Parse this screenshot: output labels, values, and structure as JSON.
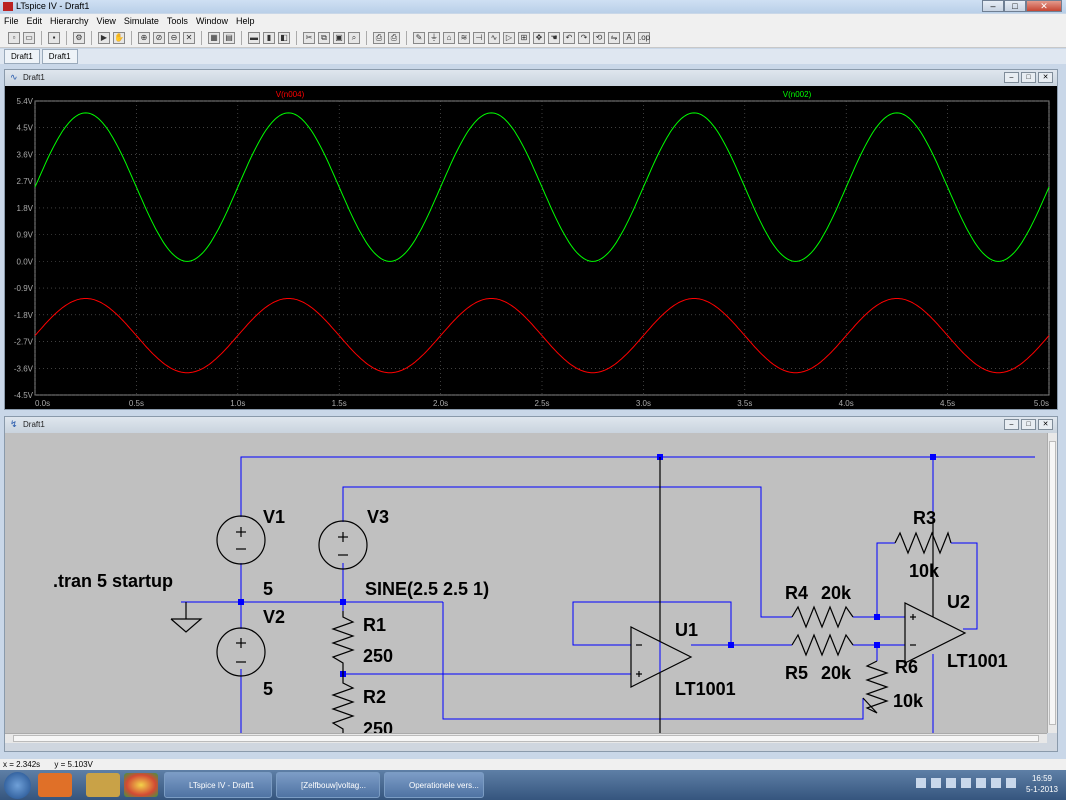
{
  "app": {
    "title": "LTspice IV - Draft1"
  },
  "menu": [
    "File",
    "Edit",
    "Hierarchy",
    "View",
    "Simulate",
    "Tools",
    "Window",
    "Help"
  ],
  "doc_tabs": [
    "Draft1",
    "Draft1"
  ],
  "plot_window": {
    "title": "Draft1"
  },
  "schematic_window": {
    "title": "Draft1"
  },
  "chart_data": {
    "type": "line",
    "xlim": [
      0,
      5
    ],
    "ylim": [
      -4.5,
      5.4
    ],
    "x_ticks": [
      "0.0s",
      "0.5s",
      "1.0s",
      "1.5s",
      "2.0s",
      "2.5s",
      "3.0s",
      "3.5s",
      "4.0s",
      "4.5s",
      "5.0s"
    ],
    "y_ticks": [
      "5.4V",
      "4.5V",
      "3.6V",
      "2.7V",
      "1.8V",
      "0.9V",
      "0.0V",
      "-0.9V",
      "-1.8V",
      "-2.7V",
      "-3.6V",
      "-4.5V"
    ],
    "y_tick_values": [
      5.4,
      4.5,
      3.6,
      2.7,
      1.8,
      0.9,
      0.0,
      -0.9,
      -1.8,
      -2.7,
      -3.6,
      -4.5
    ],
    "grid": true,
    "series": [
      {
        "name": "V(n004)",
        "color": "#ff0000",
        "kind": "sine",
        "offset": -2.5,
        "amplitude": 1.25,
        "freq": 1,
        "phase": 0
      },
      {
        "name": "V(n002)",
        "color": "#00ff00",
        "kind": "sine",
        "offset": 2.5,
        "amplitude": 2.5,
        "freq": 1,
        "phase": 0
      }
    ]
  },
  "schematic": {
    "labels": {
      "v1": "V1",
      "v1_val": "5",
      "v2": "V2",
      "v2_val": "5",
      "v3": "V3",
      "v3_val": "SINE(2.5 2.5 1)",
      "tran": ".tran 5 startup",
      "r1": "R1",
      "r1_val": "250",
      "r2": "R2",
      "r2_val": "250",
      "r3": "R3",
      "r3_val": "10k",
      "r4": "R4",
      "r4_val": "20k",
      "r5": "R5",
      "r5_val": "20k",
      "r6": "R6",
      "r6_val": "10k",
      "u1": "U1",
      "u1_val": "LT1001",
      "u2": "U2",
      "u2_val": "LT1001"
    },
    "wire_color": "#0000ff",
    "component_color": "#000000"
  },
  "status": {
    "x": "x = 2.342s",
    "y": "y = 5.103V"
  },
  "taskbar": {
    "apps": [
      "LTspice IV - Draft1",
      "[Zelfbouw]voltag...",
      "Operationele vers..."
    ],
    "time": "16:59",
    "date": "5-1-2013"
  }
}
